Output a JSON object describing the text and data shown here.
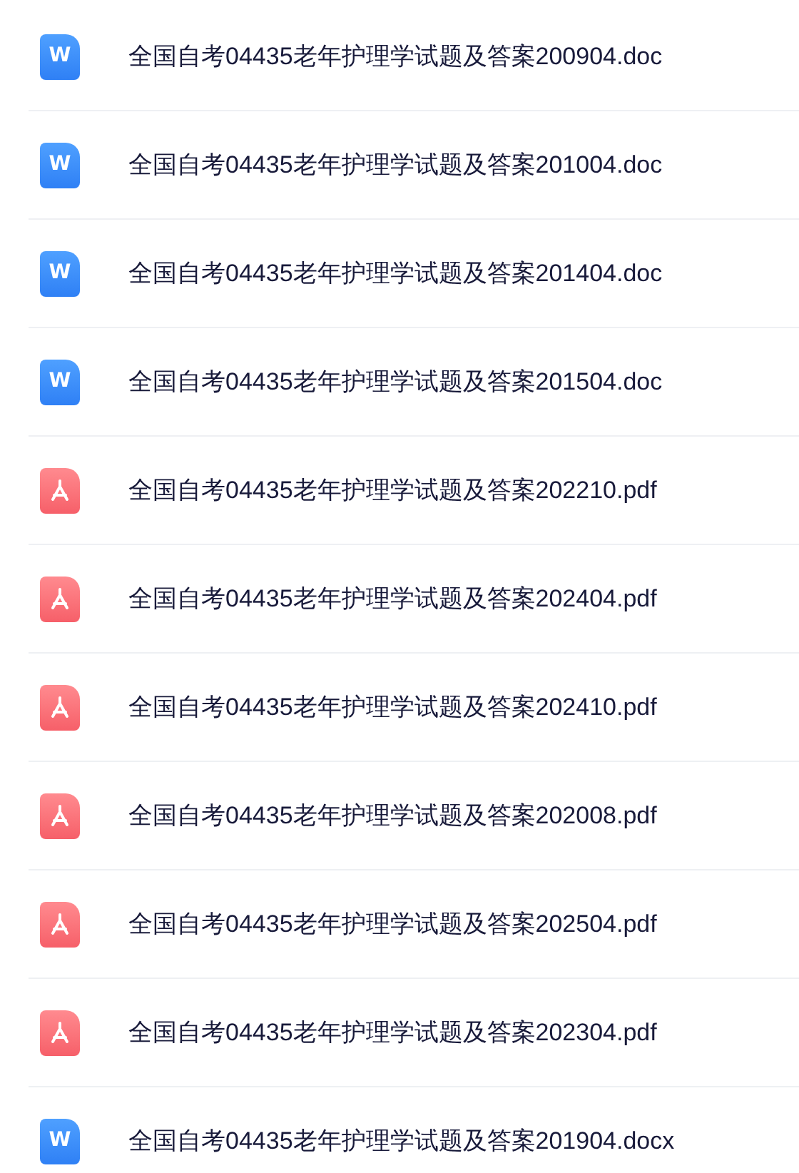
{
  "files": [
    {
      "kind": "doc",
      "icon_text": "W",
      "name": "全国自考04435老年护理学试题及答案200904.doc"
    },
    {
      "kind": "doc",
      "icon_text": "W",
      "name": "全国自考04435老年护理学试题及答案201004.doc"
    },
    {
      "kind": "doc",
      "icon_text": "W",
      "name": "全国自考04435老年护理学试题及答案201404.doc"
    },
    {
      "kind": "doc",
      "icon_text": "W",
      "name": "全国自考04435老年护理学试题及答案201504.doc"
    },
    {
      "kind": "pdf",
      "name": "全国自考04435老年护理学试题及答案202210.pdf"
    },
    {
      "kind": "pdf",
      "name": "全国自考04435老年护理学试题及答案202404.pdf"
    },
    {
      "kind": "pdf",
      "name": "全国自考04435老年护理学试题及答案202410.pdf"
    },
    {
      "kind": "pdf",
      "name": "全国自考04435老年护理学试题及答案202008.pdf"
    },
    {
      "kind": "pdf",
      "name": "全国自考04435老年护理学试题及答案202504.pdf"
    },
    {
      "kind": "pdf",
      "name": "全国自考04435老年护理学试题及答案202304.pdf"
    },
    {
      "kind": "doc",
      "icon_text": "W",
      "name": "全国自考04435老年护理学试题及答案201904.docx"
    }
  ]
}
